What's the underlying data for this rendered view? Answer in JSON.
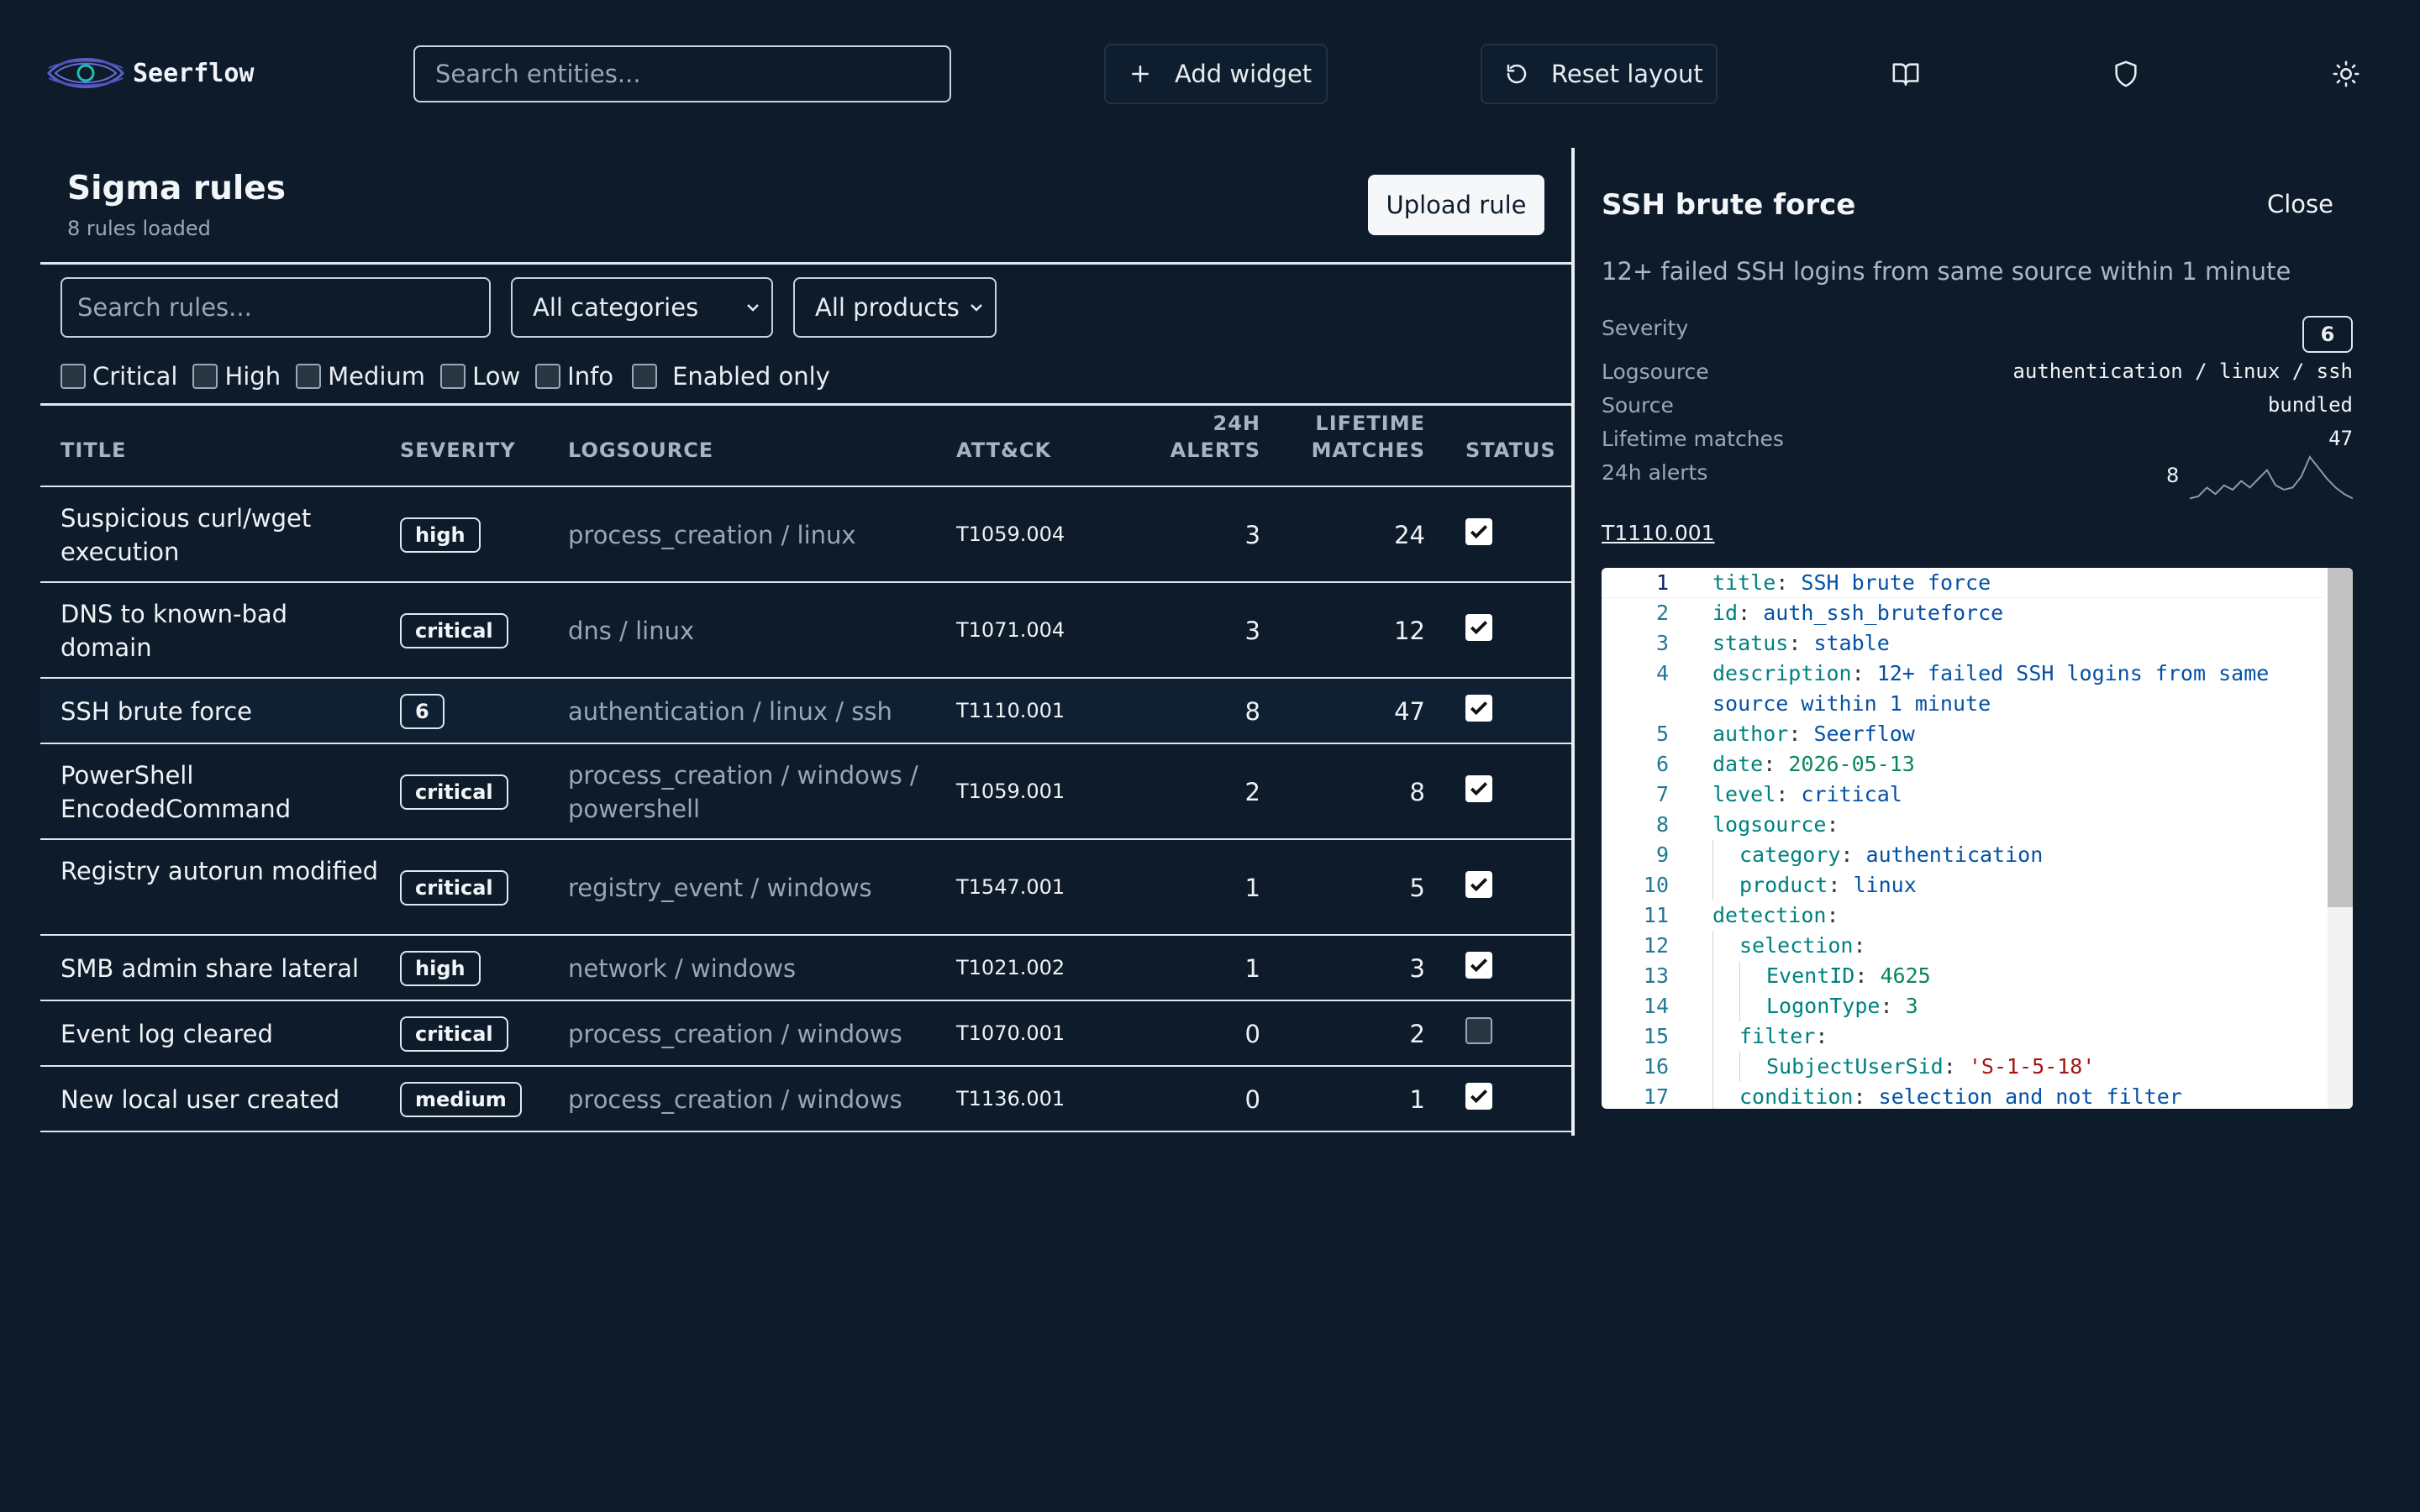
{
  "app": {
    "name": "Seerflow"
  },
  "header": {
    "search_placeholder": "Search entities...",
    "add_widget": "Add widget",
    "reset_layout": "Reset layout",
    "icons": [
      "book-open-icon",
      "shield-icon",
      "sun-icon"
    ]
  },
  "rules_panel": {
    "title": "Sigma rules",
    "subtitle": "8 rules loaded",
    "upload_label": "Upload rule",
    "search_placeholder": "Search rules...",
    "category_select": "All categories",
    "product_select": "All products",
    "filters": {
      "critical": "Critical",
      "high": "High",
      "medium": "Medium",
      "low": "Low",
      "info": "Info",
      "enabled_only": "Enabled only"
    },
    "columns": {
      "title": "TITLE",
      "severity": "SEVERITY",
      "logsource": "LOGSOURCE",
      "attack": "ATT&CK",
      "alerts_24h_1": "24H",
      "alerts_24h_2": "ALERTS",
      "lifetime_1": "LIFETIME",
      "lifetime_2": "MATCHES",
      "status": "STATUS"
    },
    "rows": [
      {
        "title": "Suspicious curl/wget execution",
        "severity": "high",
        "logsource": "process_creation / linux",
        "attack": "T1059.004",
        "alerts_24h": "3",
        "lifetime": "24",
        "enabled": true
      },
      {
        "title": "DNS to known-bad domain",
        "severity": "critical",
        "logsource": "dns / linux",
        "attack": "T1071.004",
        "alerts_24h": "3",
        "lifetime": "12",
        "enabled": true
      },
      {
        "title": "SSH brute force",
        "severity": "6",
        "logsource": "authentication / linux / ssh",
        "attack": "T1110.001",
        "alerts_24h": "8",
        "lifetime": "47",
        "enabled": true
      },
      {
        "title": "PowerShell EncodedCommand",
        "severity": "critical",
        "logsource": "process_creation / windows / powershell",
        "attack": "T1059.001",
        "alerts_24h": "2",
        "lifetime": "8",
        "enabled": true
      },
      {
        "title": "Registry autorun modified",
        "severity": "critical",
        "logsource": "registry_event / windows",
        "attack": "T1547.001",
        "alerts_24h": "1",
        "lifetime": "5",
        "enabled": true
      },
      {
        "title": "SMB admin share lateral",
        "severity": "high",
        "logsource": "network / windows",
        "attack": "T1021.002",
        "alerts_24h": "1",
        "lifetime": "3",
        "enabled": true
      },
      {
        "title": "Event log cleared",
        "severity": "critical",
        "logsource": "process_creation / windows",
        "attack": "T1070.001",
        "alerts_24h": "0",
        "lifetime": "2",
        "enabled": false
      },
      {
        "title": "New local user created",
        "severity": "medium",
        "logsource": "process_creation / windows",
        "attack": "T1136.001",
        "alerts_24h": "0",
        "lifetime": "1",
        "enabled": true
      }
    ]
  },
  "detail": {
    "title": "SSH brute force",
    "close_label": "Close",
    "description": "12+ failed SSH logins from same source within 1 minute",
    "severity_label": "Severity",
    "severity_value": "6",
    "logsource_label": "Logsource",
    "logsource_value": "authentication / linux / ssh",
    "source_label": "Source",
    "source_value": "bundled",
    "lifetime_label": "Lifetime matches",
    "lifetime_value": "47",
    "alerts_label": "24h alerts",
    "alerts_value": "8",
    "sparkline": [
      0.05,
      0.1,
      0.3,
      0.15,
      0.35,
      0.25,
      0.45,
      0.3,
      0.5,
      0.7,
      0.35,
      0.25,
      0.3,
      0.55,
      1.0,
      0.75,
      0.5,
      0.3,
      0.15,
      0.05
    ],
    "technique_link": "T1110.001",
    "yaml": [
      {
        "n": "1",
        "k": "title",
        "v": "SSH brute force",
        "t": "v",
        "indent": 0
      },
      {
        "n": "2",
        "k": "id",
        "v": "auth_ssh_bruteforce",
        "t": "v",
        "indent": 0
      },
      {
        "n": "3",
        "k": "status",
        "v": "stable",
        "t": "v",
        "indent": 0
      },
      {
        "n": "4",
        "k": "description",
        "v": "12+ failed SSH logins from same",
        "t": "v",
        "indent": 0
      },
      {
        "n": "",
        "k": "",
        "v": "source within 1 minute",
        "t": "v",
        "indent": 0
      },
      {
        "n": "5",
        "k": "author",
        "v": "Seerflow",
        "t": "v",
        "indent": 0
      },
      {
        "n": "6",
        "k": "date",
        "v": "2026-05-13",
        "t": "n",
        "indent": 0
      },
      {
        "n": "7",
        "k": "level",
        "v": "critical",
        "t": "v",
        "indent": 0
      },
      {
        "n": "8",
        "k": "logsource",
        "v": "",
        "t": "v",
        "indent": 0
      },
      {
        "n": "9",
        "k": "category",
        "v": "authentication",
        "t": "v",
        "indent": 1
      },
      {
        "n": "10",
        "k": "product",
        "v": "linux",
        "t": "v",
        "indent": 1
      },
      {
        "n": "11",
        "k": "detection",
        "v": "",
        "t": "v",
        "indent": 0
      },
      {
        "n": "12",
        "k": "selection",
        "v": "",
        "t": "v",
        "indent": 1
      },
      {
        "n": "13",
        "k": "EventID",
        "v": "4625",
        "t": "n",
        "indent": 2
      },
      {
        "n": "14",
        "k": "LogonType",
        "v": "3",
        "t": "n",
        "indent": 2
      },
      {
        "n": "15",
        "k": "filter",
        "v": "",
        "t": "v",
        "indent": 1
      },
      {
        "n": "16",
        "k": "SubjectUserSid",
        "v": "'S-1-5-18'",
        "t": "s",
        "indent": 2
      },
      {
        "n": "17",
        "k": "condition",
        "v": "selection and not filter",
        "t": "v",
        "indent": 1
      }
    ]
  },
  "colors": {
    "background": "#0d1b2a",
    "text": "#e8edf2",
    "muted": "#98a6b5",
    "code_key": "#008080",
    "code_value": "#0451a5"
  }
}
